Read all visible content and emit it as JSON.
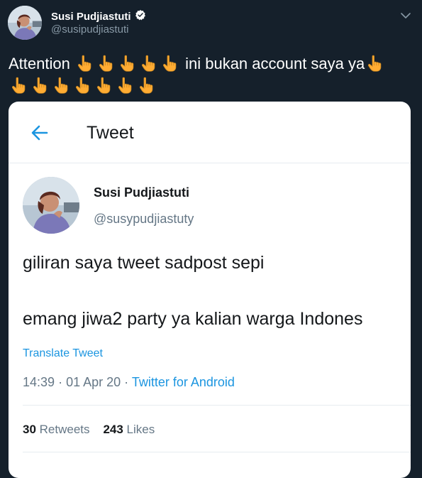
{
  "author": {
    "display_name": "Susi Pudjiastuti",
    "handle": "@susipudjiastuti"
  },
  "tweet": {
    "text_before": "Attention",
    "text_middle": "ini bukan account saya ya",
    "emoji_name": "backhand-index-pointing-up",
    "emoji_color": "#ffac33"
  },
  "embedded_screenshot": {
    "header_title": "Tweet",
    "author_name": "Susi Pudjiastuti",
    "author_handle": "@susypudjiastuty",
    "line1": "giliran saya tweet sadpost sepi",
    "line2": "emang jiwa2 party ya kalian warga Indones",
    "translate_label": "Translate Tweet",
    "time": "14:39",
    "date": "01 Apr 20",
    "source": "Twitter for Android",
    "retweets_count": "30",
    "retweets_label": "Retweets",
    "likes_count": "243",
    "likes_label": "Likes"
  },
  "colors": {
    "background": "#15202b",
    "accent": "#1b95e0",
    "secondary_text": "#8899a6"
  }
}
